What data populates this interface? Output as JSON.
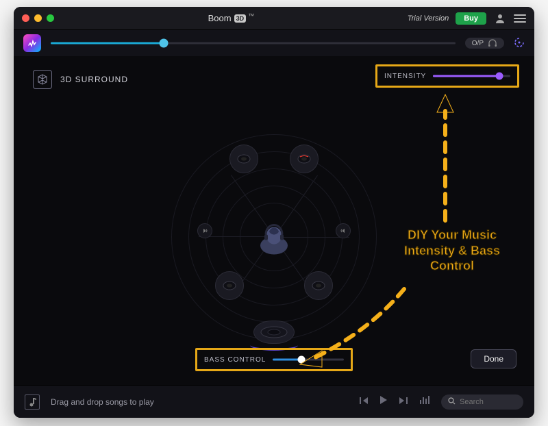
{
  "title": {
    "name": "Boom",
    "suffix": "3D",
    "tm": "™"
  },
  "header": {
    "trial": "Trial Version",
    "buy": "Buy"
  },
  "toolbar": {
    "op_label": "O/P",
    "main_volume_pct": 28
  },
  "mode": {
    "label": "3D SURROUND"
  },
  "intensity": {
    "label": "INTENSITY",
    "value_pct": 86,
    "color": "#9b5cff"
  },
  "bass": {
    "label": "BASS CONTROL",
    "value_pct": 40,
    "fill_color": "#2f8fe0",
    "thumb_color": "#ffffff"
  },
  "done": "Done",
  "annotation": {
    "text": "DIY Your Music Intensity & Bass Control"
  },
  "footer": {
    "hint": "Drag and drop songs to play",
    "search_placeholder": "Search"
  }
}
